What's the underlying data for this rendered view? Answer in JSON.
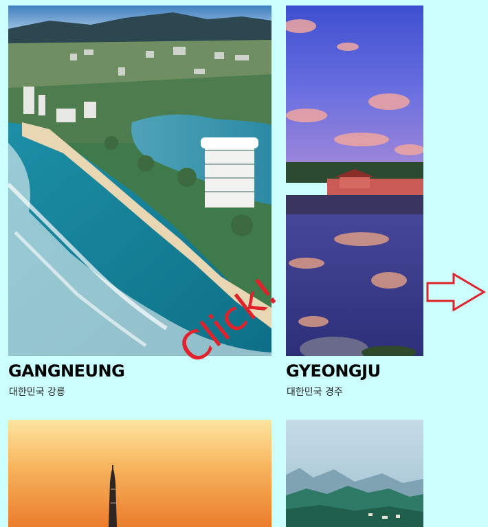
{
  "cards": [
    {
      "id": "gangneung",
      "name": "GANGNEUNG",
      "subtitle": "대한민국 강릉"
    },
    {
      "id": "gyeongju",
      "name": "GYEONGJU",
      "subtitle": "대한민국 경주"
    },
    {
      "id": "seoul",
      "name": "",
      "subtitle": ""
    },
    {
      "id": "mountain",
      "name": "",
      "subtitle": ""
    }
  ],
  "overlay": {
    "click_text": "Click!"
  },
  "colors": {
    "background": "#ccffff",
    "accent": "#e1222b"
  },
  "icons": {
    "next": "right-arrow-icon"
  }
}
